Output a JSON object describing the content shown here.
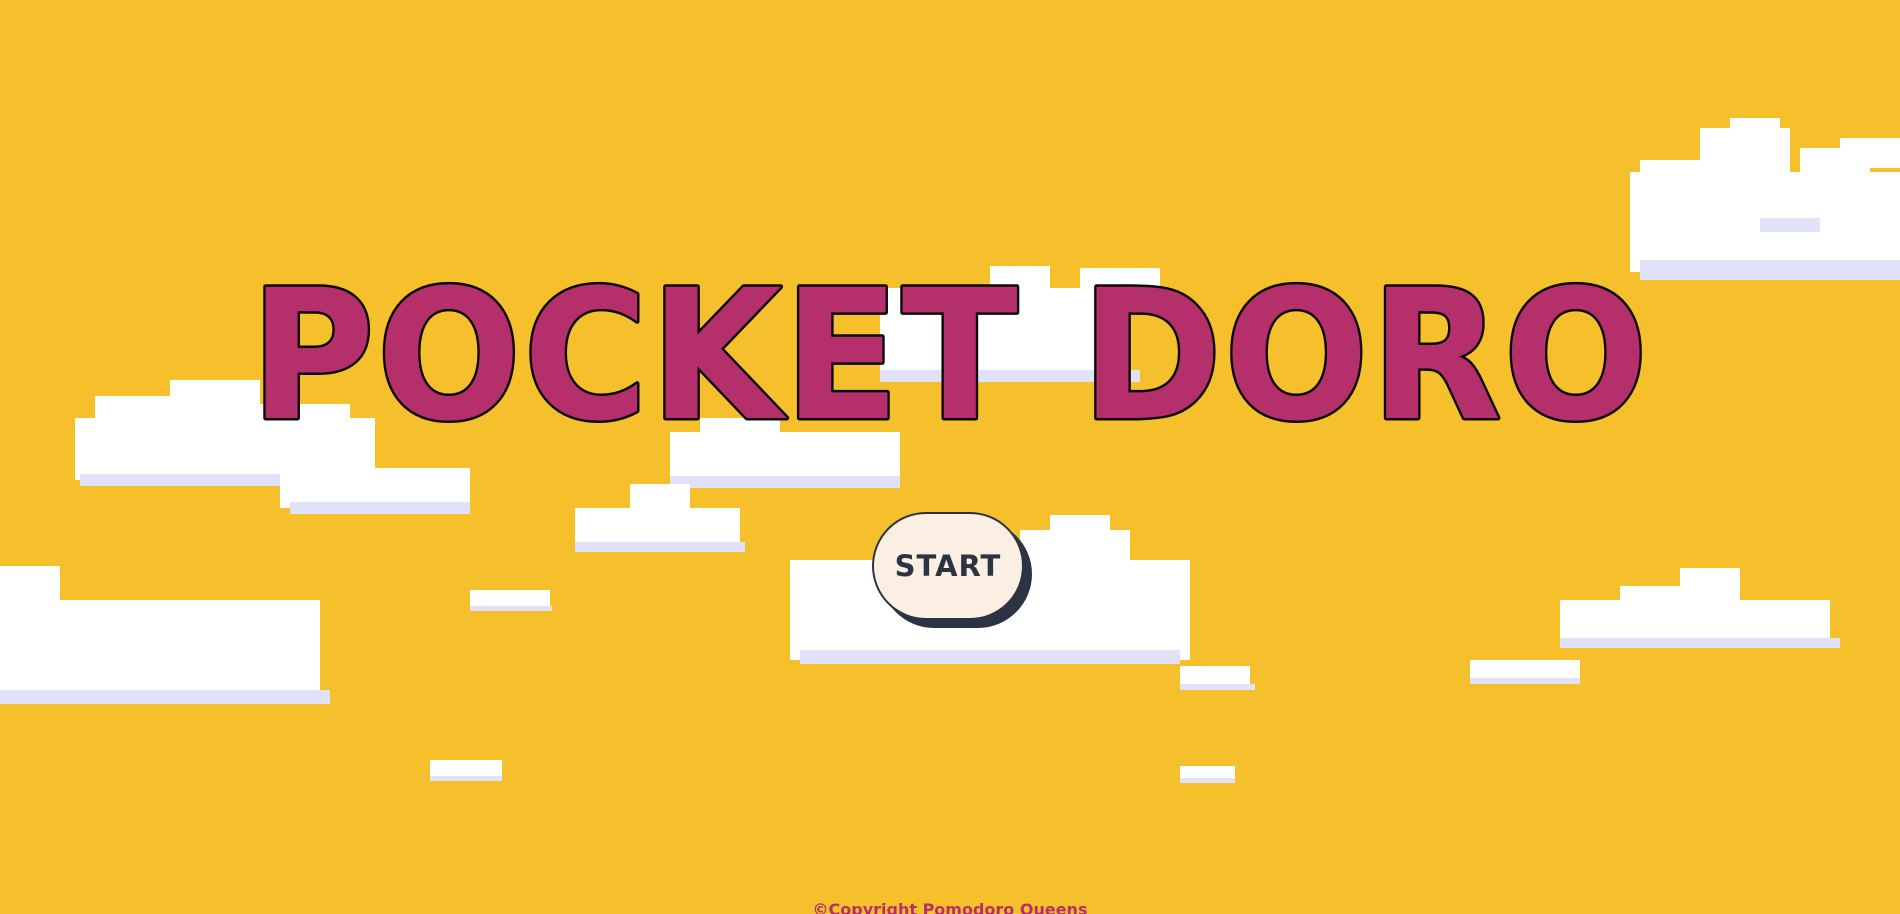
{
  "app": {
    "title": "POCKET DORO"
  },
  "start_button": {
    "label": "START"
  },
  "footer": {
    "copyright": "©Copyright Pomodoro Queens"
  },
  "colors": {
    "background": "#f6c02c",
    "title_fill": "#b5306a",
    "title_outline": "#0a0a0a",
    "button_fill": "#fbeee3",
    "button_text": "#2c3443",
    "cloud": "#ffffff",
    "cloud_shade": "#dfe2f8"
  },
  "decorations": {
    "background_icon": "pixel-cloud-icon"
  }
}
